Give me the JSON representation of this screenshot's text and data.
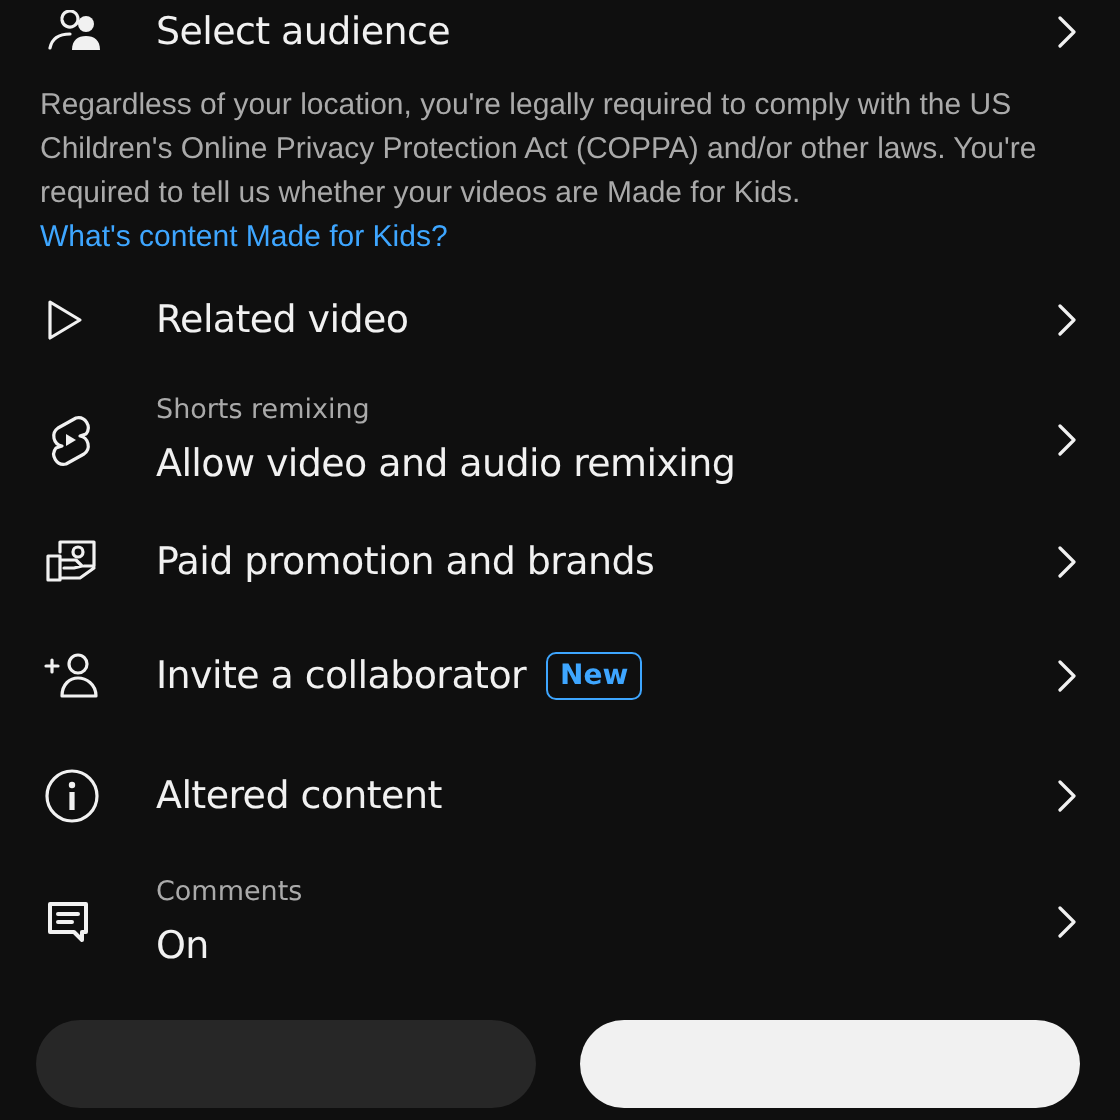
{
  "audience_row": {
    "label": "Select audience"
  },
  "notice": {
    "text": "Regardless of your location, you're legally required to comply with the US Children's Online Privacy Protection Act (COPPA) and/or other laws. You're required to tell us whether your videos are Made for Kids.",
    "link": "What's content Made for Kids?"
  },
  "items": [
    {
      "label": "Related video"
    },
    {
      "caption": "Shorts remixing",
      "label": "Allow video and audio remixing"
    },
    {
      "label": "Paid promotion and brands"
    },
    {
      "label": "Invite a collaborator",
      "badge": "New"
    },
    {
      "label": "Altered content"
    },
    {
      "caption": "Comments",
      "label": "On"
    }
  ],
  "bottom_buttons": [
    {
      "kind": "secondary"
    },
    {
      "kind": "primary"
    }
  ]
}
